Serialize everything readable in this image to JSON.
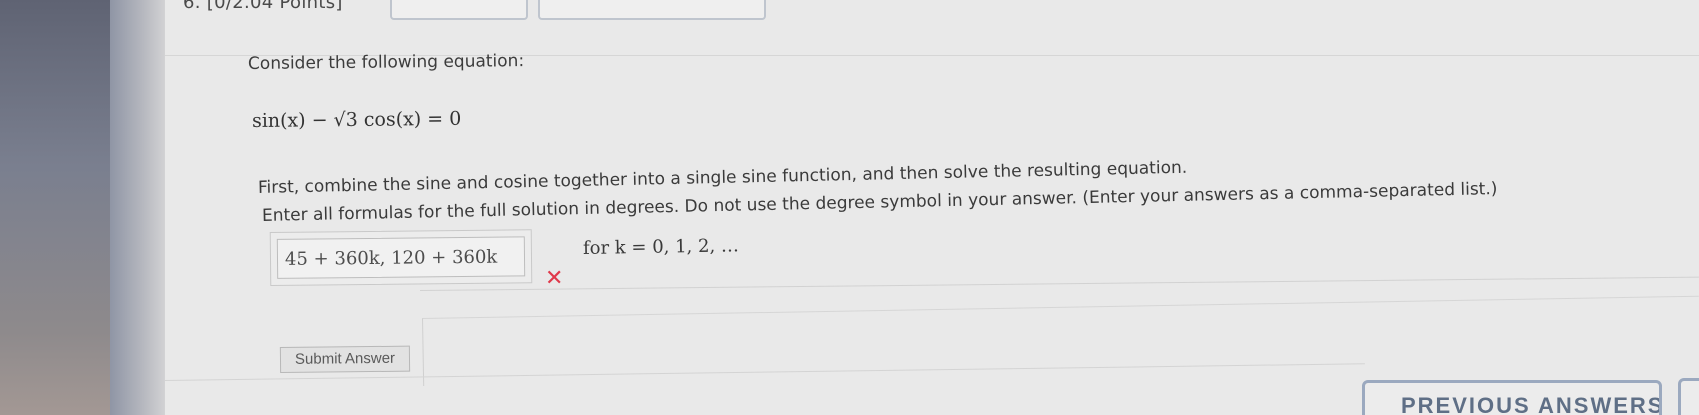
{
  "question": {
    "header": "6.  [0/2.04 Points]",
    "prompt": "Consider the following equation:",
    "equation": "sin(x) − √3 cos(x) = 0",
    "instruction_line1": "First, combine the sine and cosine together into a single sine function, and then solve the resulting equation.",
    "instruction_line2_a": "Enter all formulas for the full solution in degrees. Do not use the degree symbol in your answer. (Enter your answers as a comma-separated list.)",
    "answer_value": "45 + 360k, 120 + 360k",
    "answer_status": "incorrect",
    "k_range": "for k = 0, 1, 2, …"
  },
  "buttons": {
    "submit_label": "Submit Answer",
    "previous_answers_label": "PREVIOUS ANSWERS"
  },
  "icons": {
    "incorrect": "x-mark-icon"
  },
  "colors": {
    "incorrect": "#e0384a",
    "button_border": "#9ba9bf"
  }
}
